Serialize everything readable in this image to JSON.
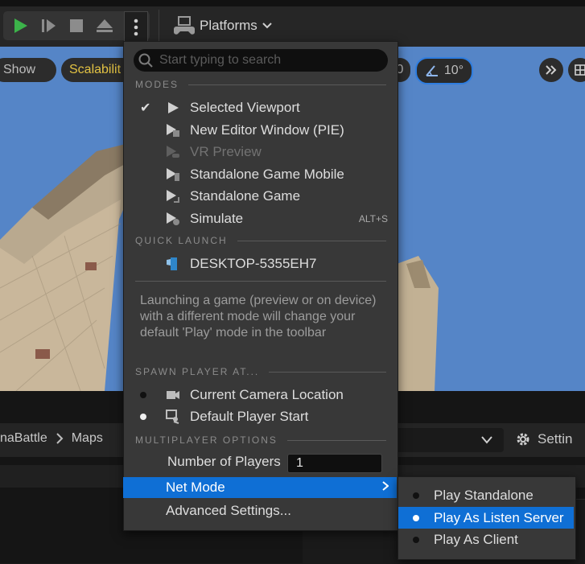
{
  "toolbar": {
    "platforms_label": "Platforms"
  },
  "viewport": {
    "show_label": "Show",
    "scalability_label": "Scalabilit",
    "grid_value_partial": "0",
    "angle_snap_value": "10°"
  },
  "menu": {
    "search_placeholder": "Start typing to search",
    "modes_header": "MODES",
    "modes": [
      {
        "label": "Selected Viewport",
        "checked": true,
        "enabled": true
      },
      {
        "label": "New Editor Window (PIE)",
        "enabled": true
      },
      {
        "label": "VR Preview",
        "enabled": false
      },
      {
        "label": "Standalone Game Mobile",
        "enabled": true
      },
      {
        "label": "Standalone Game",
        "enabled": true
      },
      {
        "label": "Simulate",
        "enabled": true,
        "shortcut": "ALT+S"
      }
    ],
    "quick_launch_header": "QUICK LAUNCH",
    "quick_launch_device": "DESKTOP-5355EH7",
    "info_text": "Launching a game (preview or on device) with a different mode will change your default 'Play' mode in the toolbar",
    "spawn_header": "SPAWN PLAYER AT...",
    "spawn_options": [
      {
        "label": "Current Camera Location",
        "selected": false
      },
      {
        "label": "Default Player Start",
        "selected": true
      }
    ],
    "multiplayer_header": "MULTIPLAYER OPTIONS",
    "num_players_label": "Number of Players",
    "num_players_value": "1",
    "net_mode_label": "Net Mode",
    "advanced_label": "Advanced Settings..."
  },
  "submenu": {
    "items": [
      {
        "label": "Play Standalone",
        "selected": false
      },
      {
        "label": "Play As Listen Server",
        "selected": true
      },
      {
        "label": "Play As Client",
        "selected": false
      }
    ]
  },
  "content_browser": {
    "breadcrumb": [
      "naBattle",
      "Maps"
    ],
    "settings_label": "Settin"
  },
  "colors": {
    "accent": "#0f6fd5",
    "play_green": "#3cb34a",
    "scalability_yellow": "#e2c243",
    "sky": "#4f80c4"
  }
}
